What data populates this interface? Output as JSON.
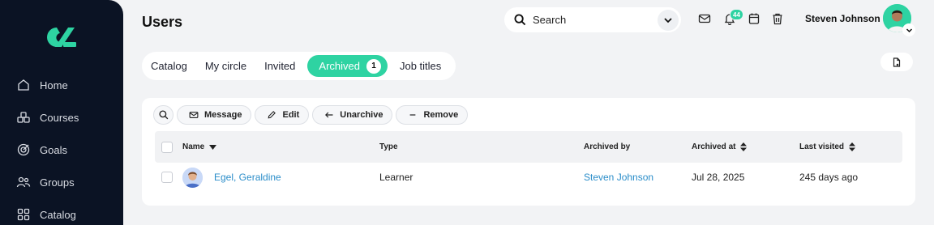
{
  "sidebar": {
    "brand_color": "#2ed3a2",
    "items": [
      {
        "label": "Home",
        "icon": "home-icon"
      },
      {
        "label": "Courses",
        "icon": "courses-icon"
      },
      {
        "label": "Goals",
        "icon": "goals-icon"
      },
      {
        "label": "Groups",
        "icon": "groups-icon"
      },
      {
        "label": "Catalog",
        "icon": "catalog-icon"
      }
    ]
  },
  "header": {
    "title": "Users",
    "search_label": "Search",
    "notification_count": "44",
    "user_name": "Steven Johnson"
  },
  "tabs": [
    {
      "label": "Catalog"
    },
    {
      "label": "My circle"
    },
    {
      "label": "Invited"
    },
    {
      "label": "Archived",
      "count": "1",
      "active": true
    },
    {
      "label": "Job titles"
    }
  ],
  "toolbar": {
    "message_label": "Message",
    "edit_label": "Edit",
    "unarchive_label": "Unarchive",
    "remove_label": "Remove"
  },
  "table": {
    "columns": [
      "Name",
      "Type",
      "Archived by",
      "Archived at",
      "Last visited"
    ],
    "rows": [
      {
        "name": "Egel, Geraldine",
        "type": "Learner",
        "archived_by": "Steven Johnson",
        "archived_at": "Jul 28, 2025",
        "last_visited": "245 days ago"
      }
    ]
  }
}
